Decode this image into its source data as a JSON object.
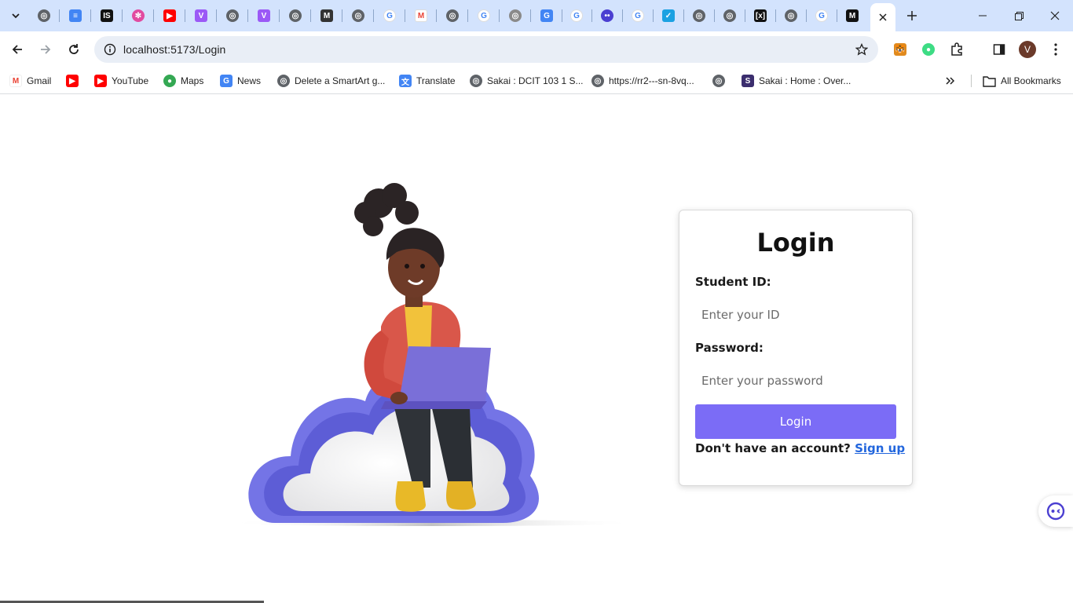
{
  "browser": {
    "address": "localhost:5173/Login",
    "profile_initial": "V",
    "bookmarks": [
      {
        "label": "Gmail",
        "icon": "gmail-icon"
      },
      {
        "label": "",
        "icon": "youtube-icon"
      },
      {
        "label": "YouTube",
        "icon": "youtube-icon"
      },
      {
        "label": "Maps",
        "icon": "maps-icon"
      },
      {
        "label": "News",
        "icon": "news-icon"
      },
      {
        "label": "Delete a SmartArt g...",
        "icon": "globe-icon"
      },
      {
        "label": "Translate",
        "icon": "translate-icon"
      },
      {
        "label": "Sakai : DCIT 103 1 S...",
        "icon": "globe-icon"
      },
      {
        "label": "https://rr2---sn-8vq...",
        "icon": "globe-icon"
      },
      {
        "label": "",
        "icon": "globe-icon"
      },
      {
        "label": "Sakai : Home : Over...",
        "icon": "sakai-icon"
      }
    ],
    "all_bookmarks": "All Bookmarks",
    "colors": {
      "tabstrip": "#d3e3fd",
      "omnibox": "#e9eef6",
      "accent": "#7b6cf6",
      "link": "#2266dd"
    }
  },
  "login": {
    "title": "Login",
    "student_id_label": "Student ID:",
    "student_id_placeholder": "Enter your ID",
    "password_label": "Password:",
    "password_placeholder": "Enter your password",
    "submit_label": "Login",
    "no_account_text": "Don't have an account?",
    "signup_label": "Sign up"
  }
}
